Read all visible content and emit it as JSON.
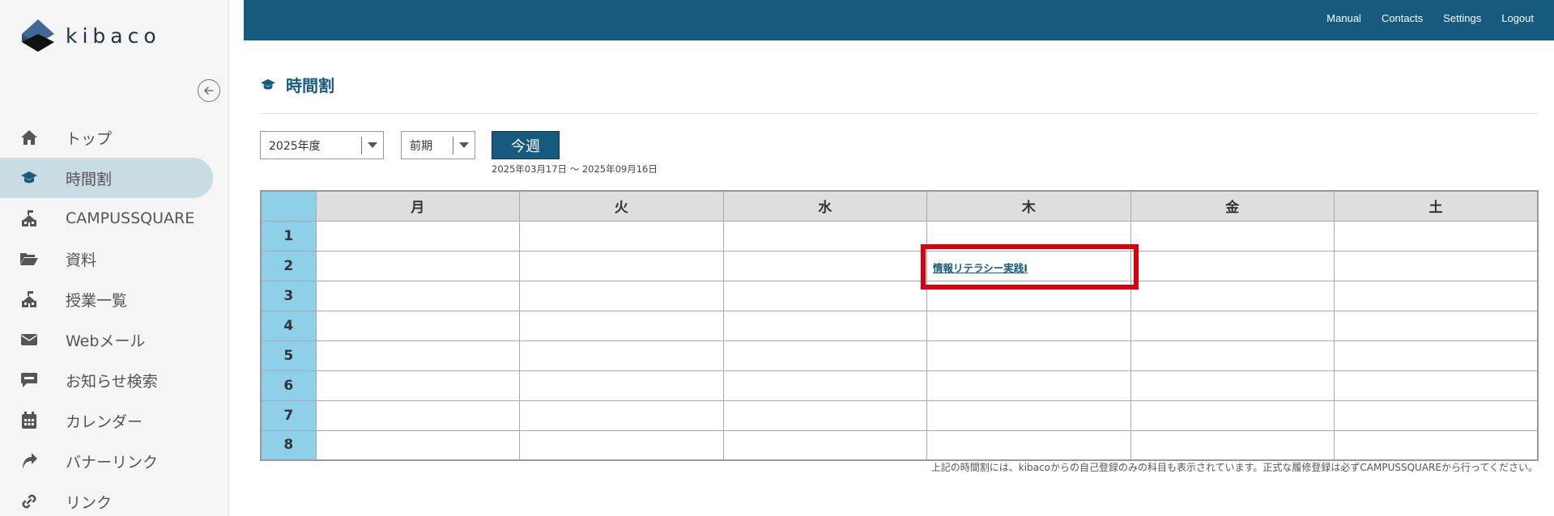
{
  "logo": {
    "text": "kibaco"
  },
  "sidebar": {
    "items": [
      {
        "label": "トップ",
        "icon": "home-icon",
        "active": false
      },
      {
        "label": "時間割",
        "icon": "graduation-cap-icon",
        "active": true
      },
      {
        "label": "CAMPUSSQUARE",
        "icon": "school-building-icon",
        "active": false
      },
      {
        "label": "資料",
        "icon": "folder-open-icon",
        "active": false
      },
      {
        "label": "授業一覧",
        "icon": "school-building-icon",
        "active": false
      },
      {
        "label": "Webメール",
        "icon": "envelope-icon",
        "active": false
      },
      {
        "label": "お知らせ検索",
        "icon": "info-chat-icon",
        "active": false
      },
      {
        "label": "カレンダー",
        "icon": "calendar-icon",
        "active": false
      },
      {
        "label": "バナーリンク",
        "icon": "share-arrow-icon",
        "active": false
      },
      {
        "label": "リンク",
        "icon": "link-icon",
        "active": false
      }
    ]
  },
  "topnav": {
    "manual": "Manual",
    "contacts": "Contacts",
    "settings": "Settings",
    "logout": "Logout"
  },
  "page": {
    "title": "時間割",
    "year_select": "2025年度",
    "term_select": "前期",
    "this_week": "今週",
    "date_range": "2025年03月17日 〜 2025年09月16日",
    "footnote": "上記の時間割には、kibacoからの自己登録のみの科目も表示されています。正式な履修登録は必ずCAMPUSSQUAREから行ってください。"
  },
  "timetable": {
    "days": [
      "月",
      "火",
      "水",
      "木",
      "金",
      "土"
    ],
    "periods": [
      "1",
      "2",
      "3",
      "4",
      "5",
      "6",
      "7",
      "8"
    ],
    "courses": [
      {
        "period": "2",
        "day": "木",
        "name": "情報リテラシー実践Ⅰ"
      }
    ]
  },
  "colors": {
    "primary": "#165a80",
    "sidebar_active": "#c9dce3",
    "period_cell": "#8dd0e8",
    "highlight": "#d7000f"
  }
}
